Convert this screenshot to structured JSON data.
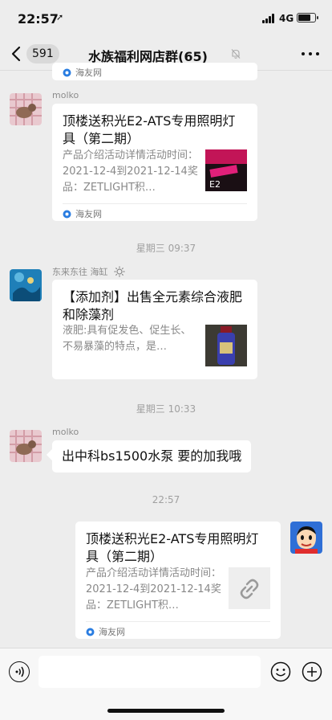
{
  "status": {
    "time": "22:57",
    "location_glyph": "➚",
    "network": "4G",
    "battery_level": 0.75
  },
  "nav": {
    "back_count": "591",
    "title": "水族福利网店群(65)"
  },
  "messages": {
    "top_card_source": "海友网",
    "msg1": {
      "sender": "molko",
      "title": "顶楼送积光E2-ATS专用照明灯具（第二期）",
      "desc": "产品介绍活动详情活动时间：2021-12-4到2021-12-14奖品：ZETLIGHT积…",
      "source": "海友网",
      "thumb_text": "E2"
    },
    "time1": "星期三 09:37",
    "msg2": {
      "sender": "东来东往 海缸",
      "title": "【添加剂】出售全元素综合液肥和除藻剂",
      "desc": "液肥:具有促发色、促生长、不易暴藻的特点，是…"
    },
    "time2": "星期三 10:33",
    "msg3": {
      "sender": "molko",
      "text": "出中科bs1500水泵 要的加我哦"
    },
    "time3": "22:57",
    "msg4": {
      "title": "顶楼送积光E2-ATS专用照明灯具（第二期）",
      "desc": "产品介绍活动详情活动时间：2021-12-4到2021-12-14奖品：ZETLIGHT积…",
      "source": "海友网"
    }
  },
  "colors": {
    "background": "#ededed",
    "bubble": "#ffffff",
    "meta_text": "#a0a0a0",
    "source_icon": "#2a7de1"
  }
}
